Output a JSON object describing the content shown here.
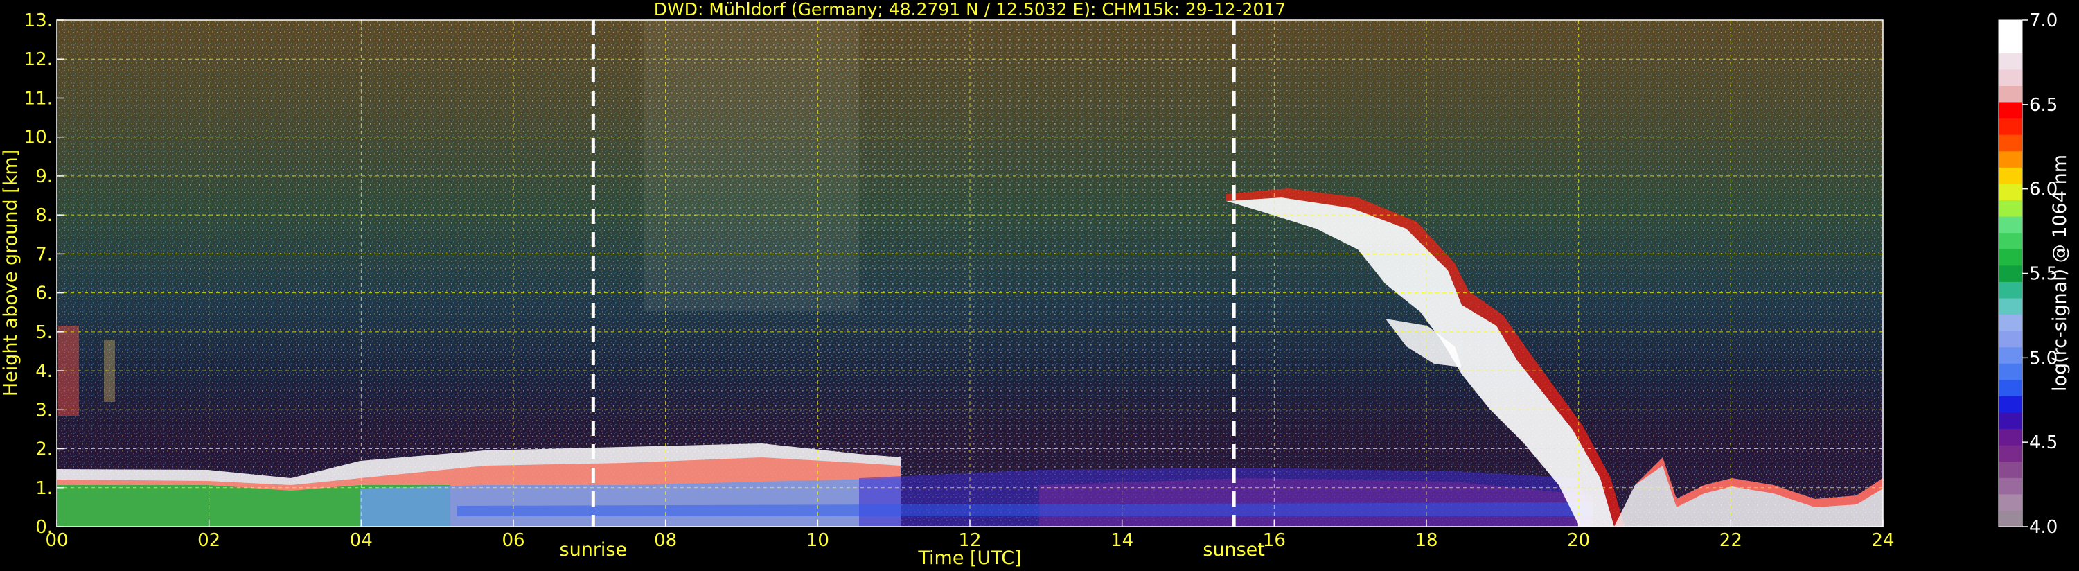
{
  "chart_data": {
    "type": "heatmap",
    "title": "DWD: Mühldorf (Germany; 48.2791 N / 12.5032 E):    CHM15k: 29-12-2017",
    "xlabel": "Time [UTC]",
    "ylabel": "Height above ground [km]",
    "xlim": [
      0,
      24
    ],
    "ylim": [
      0,
      13
    ],
    "x_ticks": [
      "00",
      "02",
      "04",
      "06",
      "08",
      "10",
      "12",
      "14",
      "16",
      "18",
      "20",
      "22",
      "24"
    ],
    "y_ticks": [
      "0.",
      "1.",
      "2.",
      "3.",
      "4.",
      "5.",
      "6.",
      "7.",
      "8.",
      "9.",
      "10.",
      "11.",
      "12.",
      "13."
    ],
    "grid": true,
    "markers": [
      {
        "label": "sunrise",
        "x": 7.05
      },
      {
        "label": "sunset",
        "x": 15.47
      }
    ],
    "colorbar": {
      "label": "log(rc-signal) @ 1064 nm",
      "range": [
        4.0,
        7.0
      ],
      "ticks": [
        "4.0",
        "4.5",
        "5.0",
        "5.5",
        "6.0",
        "6.5",
        "7.0"
      ],
      "colors": [
        "#9a8a9a",
        "#a88aa8",
        "#9a6a9e",
        "#8a4a90",
        "#7a2a8a",
        "#6a1a90",
        "#3a10b0",
        "#1a20e0",
        "#2a5af0",
        "#4a7af2",
        "#6a90f2",
        "#8aa0ee",
        "#98b0ee",
        "#60c8c0",
        "#30b890",
        "#10a040",
        "#20b840",
        "#40d060",
        "#60e080",
        "#a0f040",
        "#e0f020",
        "#ffd000",
        "#ff9000",
        "#ff5000",
        "#ff2000",
        "#ff0000",
        "#e8b0b0",
        "#f0d0d8",
        "#f0e0e8",
        "#ffffff",
        "#ffffff"
      ]
    }
  }
}
